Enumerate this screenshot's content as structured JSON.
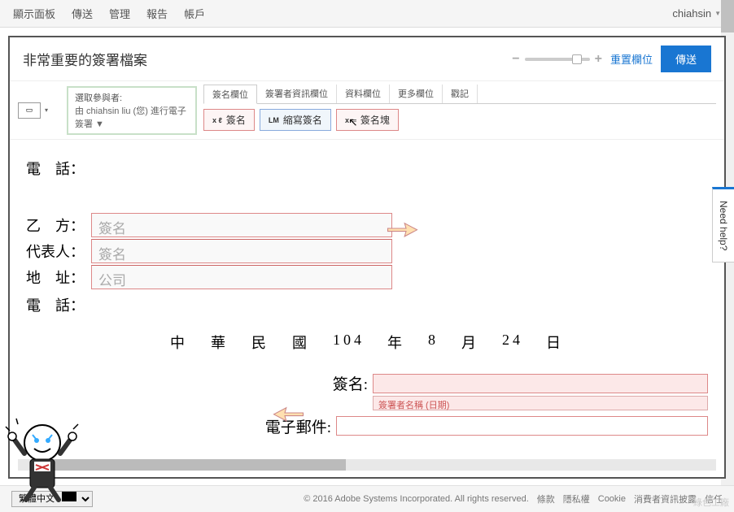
{
  "topMenu": {
    "items": [
      "顯示面板",
      "傳送",
      "管理",
      "報告",
      "帳戶"
    ],
    "username": "chiahsin"
  },
  "panel": {
    "title": "非常重要的簽署檔案",
    "resetLink": "重置欄位",
    "sendButton": "傳送"
  },
  "participant": {
    "label": "選取參與者:",
    "value": "由 chiahsin liu (您) 進行電子簽署 ▼"
  },
  "tabs": [
    "簽名欄位",
    "簽署者資訊欄位",
    "資料欄位",
    "更多欄位",
    "戳記"
  ],
  "tools": {
    "sign": {
      "prefix": "x ℓ",
      "label": "簽名"
    },
    "initial": {
      "prefix": "LM",
      "label": "縮寫簽名"
    },
    "block": {
      "prefix": "x ═",
      "label": "簽名塊"
    }
  },
  "doc": {
    "phone": "電　話：",
    "partyB": "乙　方：",
    "rep": "代表人：",
    "addr": "地　址：",
    "phone2": "電　話：",
    "sigPlaceholder": "簽名",
    "companyPlaceholder": "公司",
    "dateParts": [
      "中",
      "華",
      "民",
      "國",
      "104",
      "年",
      "8",
      "月",
      "24",
      "日"
    ],
    "sigLabel": "簽名:",
    "emailLabel": "電子郵件:",
    "sigMeta": "簽署者名稱 (日期)"
  },
  "footer": {
    "language": "繁體中文",
    "copyright": "© 2016 Adobe Systems Incorporated. All rights reserved.",
    "links": [
      "條款",
      "隱私權",
      "Cookie",
      "消費者資訊披露",
      "信任"
    ]
  },
  "helpTab": "Need help?",
  "watermark": "綠色工廠"
}
